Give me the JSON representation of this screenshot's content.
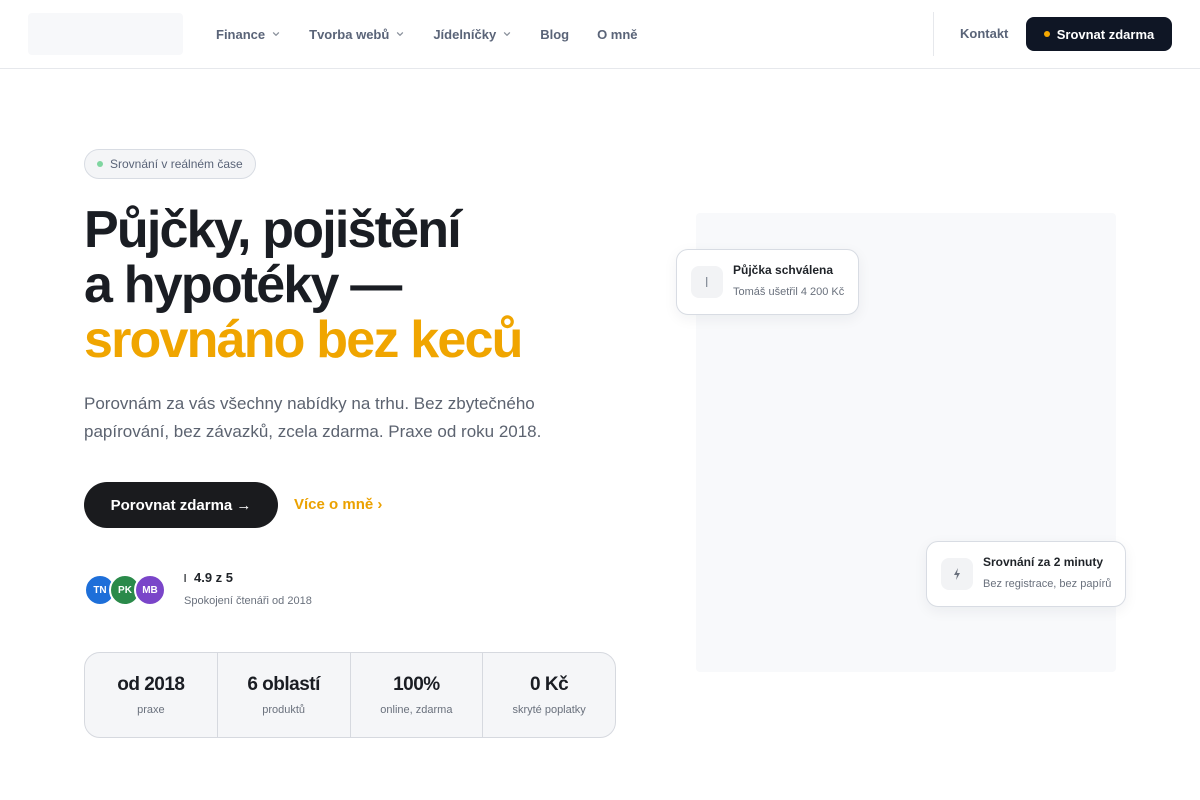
{
  "nav": {
    "items": [
      {
        "label": "Finance",
        "dropdown": true
      },
      {
        "label": "Tvorba webů",
        "dropdown": true
      },
      {
        "label": "Jídelníčky",
        "dropdown": true
      },
      {
        "label": "Blog",
        "dropdown": false
      },
      {
        "label": "O mně",
        "dropdown": false
      }
    ],
    "contact": "Kontakt",
    "cta": "Srovnat zdarma"
  },
  "hero": {
    "badge": "Srovnání v reálném čase",
    "title_line1": "Půjčky, pojištění",
    "title_line2": "a hypotéky —",
    "title_accent": "srovnáno bez keců",
    "lead": "Porovnám za vás všechny nabídky na trhu. Bez zbytečného papírování, bez závazků, zcela zdarma. Praxe od roku 2018.",
    "primary_button": "Porovnat zdarma →",
    "secondary_link": "Více o mně ›",
    "avatars": [
      {
        "initials": "TN",
        "color": "#1e6fd9"
      },
      {
        "initials": "PK",
        "color": "#2a8a4a"
      },
      {
        "initials": "MB",
        "color": "#7a45c9"
      }
    ],
    "rating": "4.9 z 5",
    "rating_sub": "Spokojení čtenáři od 2018"
  },
  "stats": [
    {
      "value": "od 2018",
      "label": "praxe"
    },
    {
      "value": "6 oblastí",
      "label": "produktů"
    },
    {
      "value": "100%",
      "label": "online, zdarma"
    },
    {
      "value": "0 Kč",
      "label": "skryté poplatky"
    }
  ],
  "cards": {
    "approved": {
      "title": "Půjčka schválena",
      "sub": "Tomáš ušetřil 4 200 Kč",
      "icon": "check-icon"
    },
    "speed": {
      "title": "Srovnání za 2 minuty",
      "sub": "Bez registrace, bez papírů",
      "icon": "lightning-icon"
    }
  },
  "colors": {
    "accent": "#f0a500",
    "dark": "#0f1625"
  }
}
